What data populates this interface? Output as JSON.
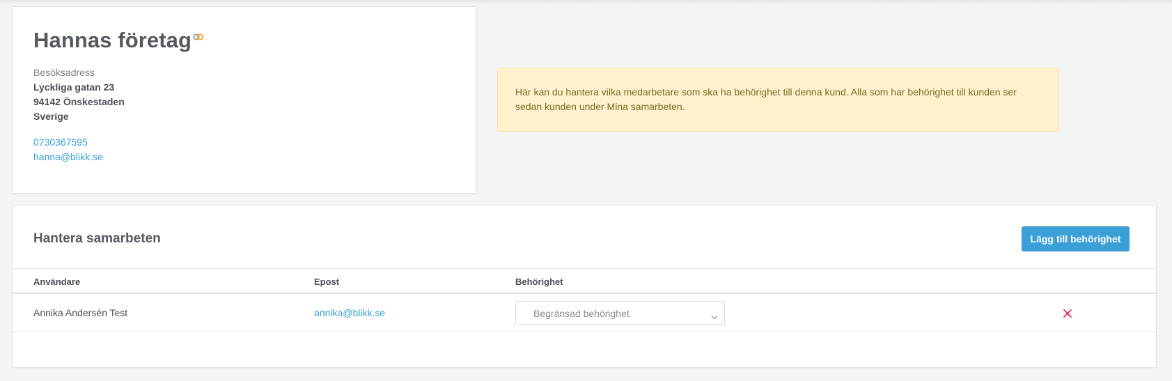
{
  "company": {
    "name": "Hannas företag",
    "address_label": "Besöksadress",
    "address_lines": [
      "Lyckliga gatan 23",
      "94142 Önskestaden",
      "Sverige"
    ],
    "phone": "0730367595",
    "email": "hanna@blikk.se",
    "link_icon": "link-icon"
  },
  "notice": {
    "text": "Här kan du hantera vilka medarbetare som ska ha behörighet till denna kund. Alla som har behörighet till kunden ser sedan kunden under Mina samarbeten."
  },
  "collaborations": {
    "title": "Hantera samarbeten",
    "add_button_label": "Lägg till behörighet",
    "columns": [
      "Användare",
      "Epost",
      "Behörighet"
    ],
    "rows": [
      {
        "user": "Annika Andersén Test",
        "email": "annika@blikk.se",
        "permission": "Begränsad behörighet"
      }
    ]
  },
  "colors": {
    "accent": "#3b9fd8",
    "notice_bg": "#fef1cc",
    "danger": "#e0245e",
    "link_icon_orange": "#f5a623"
  },
  "icons": {
    "select_chevron": "chevron-down-icon",
    "remove": "close-icon"
  }
}
